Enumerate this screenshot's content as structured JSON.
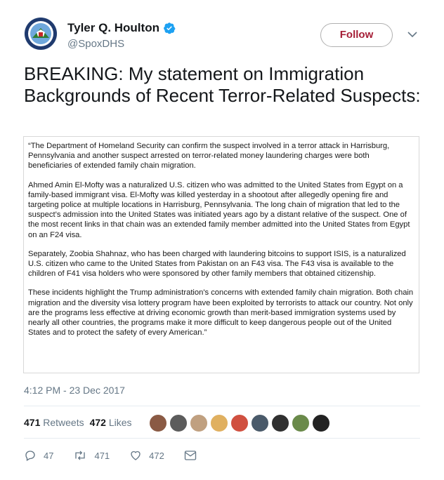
{
  "author": {
    "display_name": "Tyler Q. Houlton",
    "handle": "@SpoxDHS",
    "avatar_icon": "dhs-seal-icon",
    "verified_icon": "verified-badge-icon"
  },
  "follow_label": "Follow",
  "headline": "BREAKING: My statement on Immigration Backgrounds of Recent Terror-Related Suspects:",
  "statement_paragraphs": [
    "“The Department of Homeland Security can confirm the suspect involved in a terror attack in Harrisburg, Pennsylvania and another suspect arrested on terror-related money laundering charges were both beneficiaries of extended family chain migration.",
    "Ahmed Amin El-Mofty was a naturalized U.S. citizen who was admitted to the United States from Egypt on a family-based immigrant visa. El-Mofty was killed yesterday in a shootout after allegedly opening fire and targeting police at multiple locations in Harrisburg, Pennsylvania. The long chain of migration that led to the suspect’s admission into the United States was initiated years ago by a distant relative of the suspect. One of the most recent links in that chain was an extended family member admitted into the United States from Egypt on an F24 visa.",
    "Separately, Zoobia Shahnaz, who has been charged with laundering bitcoins to support ISIS, is a naturalized U.S. citizen who came to the United States from Pakistan on an F43 visa. The F43 visa is available to the children of F41 visa holders who were sponsored by other family members that obtained citizenship.",
    "These incidents highlight the Trump administration's concerns with extended family chain migration. Both chain migration and the diversity visa lottery program have been exploited by terrorists to attack our country.  Not only are the programs less effective at driving economic growth than merit-based immigration systems used by nearly all other countries, the programs make it more difficult to keep dangerous people out of the United States and to protect the safety of every American.”"
  ],
  "timestamp": "4:12 PM - 23 Dec 2017",
  "stats": {
    "retweets_count": "471",
    "retweets_label": "Retweets",
    "likes_count": "472",
    "likes_label": "Likes"
  },
  "liker_avatars": [
    "#8a5a44",
    "#5c5c5c",
    "#c0a080",
    "#e0b060",
    "#d05040",
    "#4a5a6a",
    "#303030",
    "#6a8a4a",
    "#222222"
  ],
  "actions": {
    "reply_count": "47",
    "retweet_count": "471",
    "like_count": "472"
  },
  "colors": {
    "follow_text": "#a51e36",
    "verified": "#1da1f2",
    "muted": "#657786"
  }
}
